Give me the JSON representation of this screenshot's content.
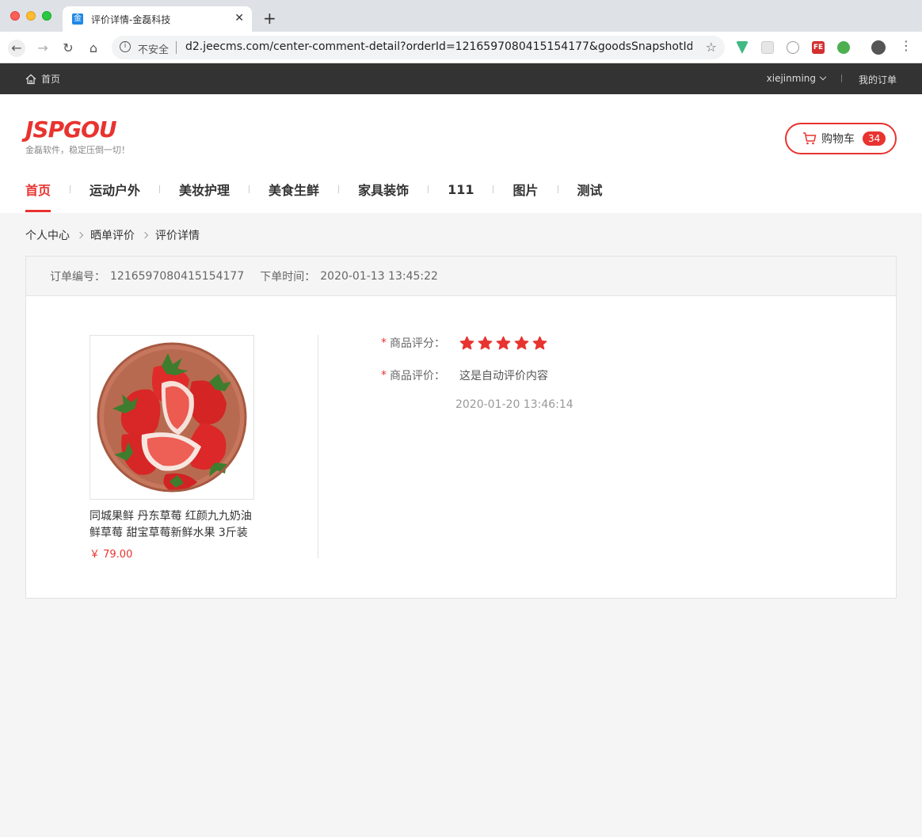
{
  "browser": {
    "tab_title": "评价详情-金磊科技",
    "tab_favicon": "金",
    "url_security": "不安全",
    "url": "d2.jeecms.com/center-comment-detail?orderId=1216597080415154177&goodsSnapshotId=12..."
  },
  "topbar": {
    "home": "首页",
    "username": "xiejinming",
    "my_orders": "我的订单"
  },
  "header": {
    "logo": "JSPGOU",
    "slogan": "金磊软件，稳定压倒一切！",
    "cart_label": "购物车",
    "cart_count": "34"
  },
  "nav": {
    "items": [
      "首页",
      "运动户外",
      "美妆护理",
      "美食生鲜",
      "家具装饰",
      "111",
      "图片",
      "测试"
    ],
    "active": "首页"
  },
  "breadcrumb": [
    "个人中心",
    "晒单评价",
    "评价详情"
  ],
  "order": {
    "number_label": "订单编号：",
    "number": "1216597080415154177",
    "time_label": "下单时间：",
    "time": "2020-01-13 13:45:22"
  },
  "product": {
    "name": "同城果鲜 丹东草莓 红颜九九奶油鲜草莓 甜宝草莓新鲜水果 3斤装",
    "price": "￥ 79.00"
  },
  "review": {
    "rating_label": "商品评分：",
    "rating": 5,
    "rating_max": 5,
    "comment_label": "商品评价：",
    "comment": "这是自动评价内容",
    "time": "2020-01-20 13:46:14"
  },
  "colors": {
    "accent": "#e8332f",
    "topbar": "#333333"
  }
}
